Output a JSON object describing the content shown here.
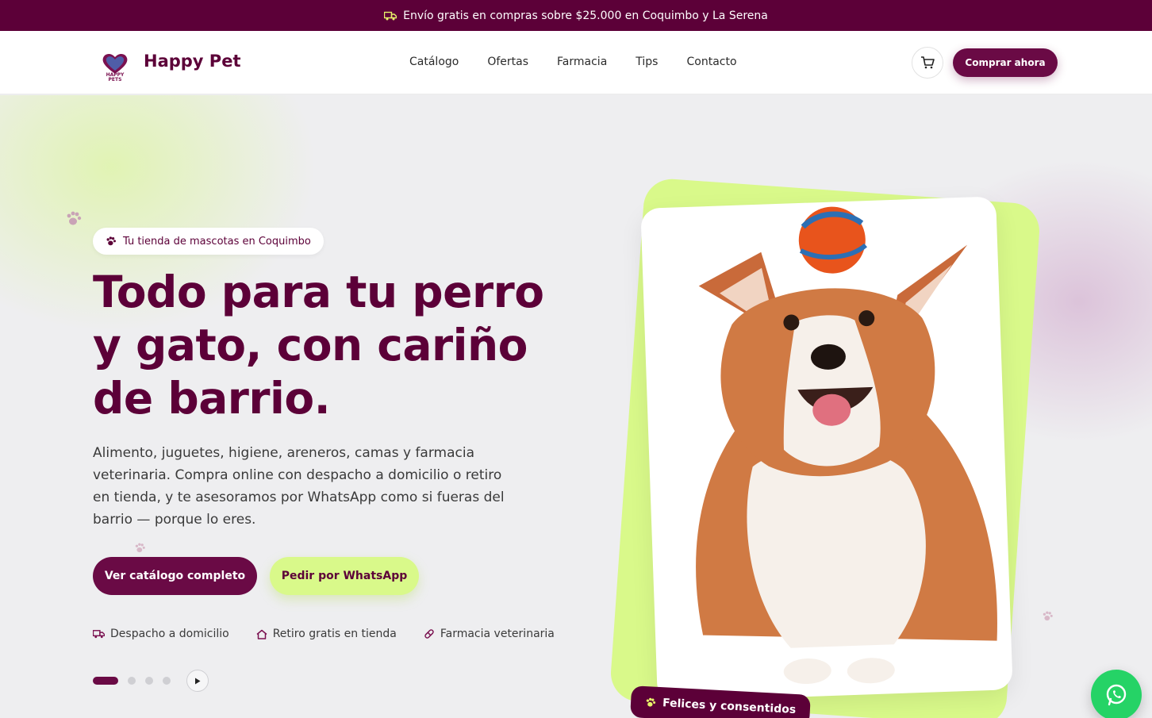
{
  "announcement": {
    "icon": "truck-icon",
    "text": "Envío gratis en compras sobre $25.000 en Coquimbo y La Serena"
  },
  "header": {
    "logo_text": "HAPPY PETS",
    "brand": "Happy Pet",
    "nav": [
      "Catálogo",
      "Ofertas",
      "Farmacia",
      "Tips",
      "Contacto"
    ],
    "cart_icon": "cart-icon",
    "cta": "Comprar ahora"
  },
  "hero": {
    "badge": "Tu tienda de mascotas en Coquimbo",
    "headline": "Todo para tu perro y gato, con cariño de barrio.",
    "description": "Alimento, juguetes, higiene, areneros, camas y farmacia veterinaria. Compra online con despacho a domicilio o retiro en tienda, y te asesoramos por WhatsApp como si fueras del barrio — porque lo eres.",
    "primary_button": "Ver catálogo completo",
    "secondary_button": "Pedir por WhatsApp",
    "features": [
      {
        "icon": "truck-icon",
        "label": "Despacho a domicilio"
      },
      {
        "icon": "home-icon",
        "label": "Retiro gratis en tienda"
      },
      {
        "icon": "pill-icon",
        "label": "Farmacia veterinaria"
      }
    ],
    "slides": {
      "count": 4,
      "active": 1
    },
    "image_caption": "Felices y consentidos"
  },
  "colors": {
    "brand": "#5c0038",
    "accent": "#d9f98a",
    "whatsapp": "#25d366"
  }
}
